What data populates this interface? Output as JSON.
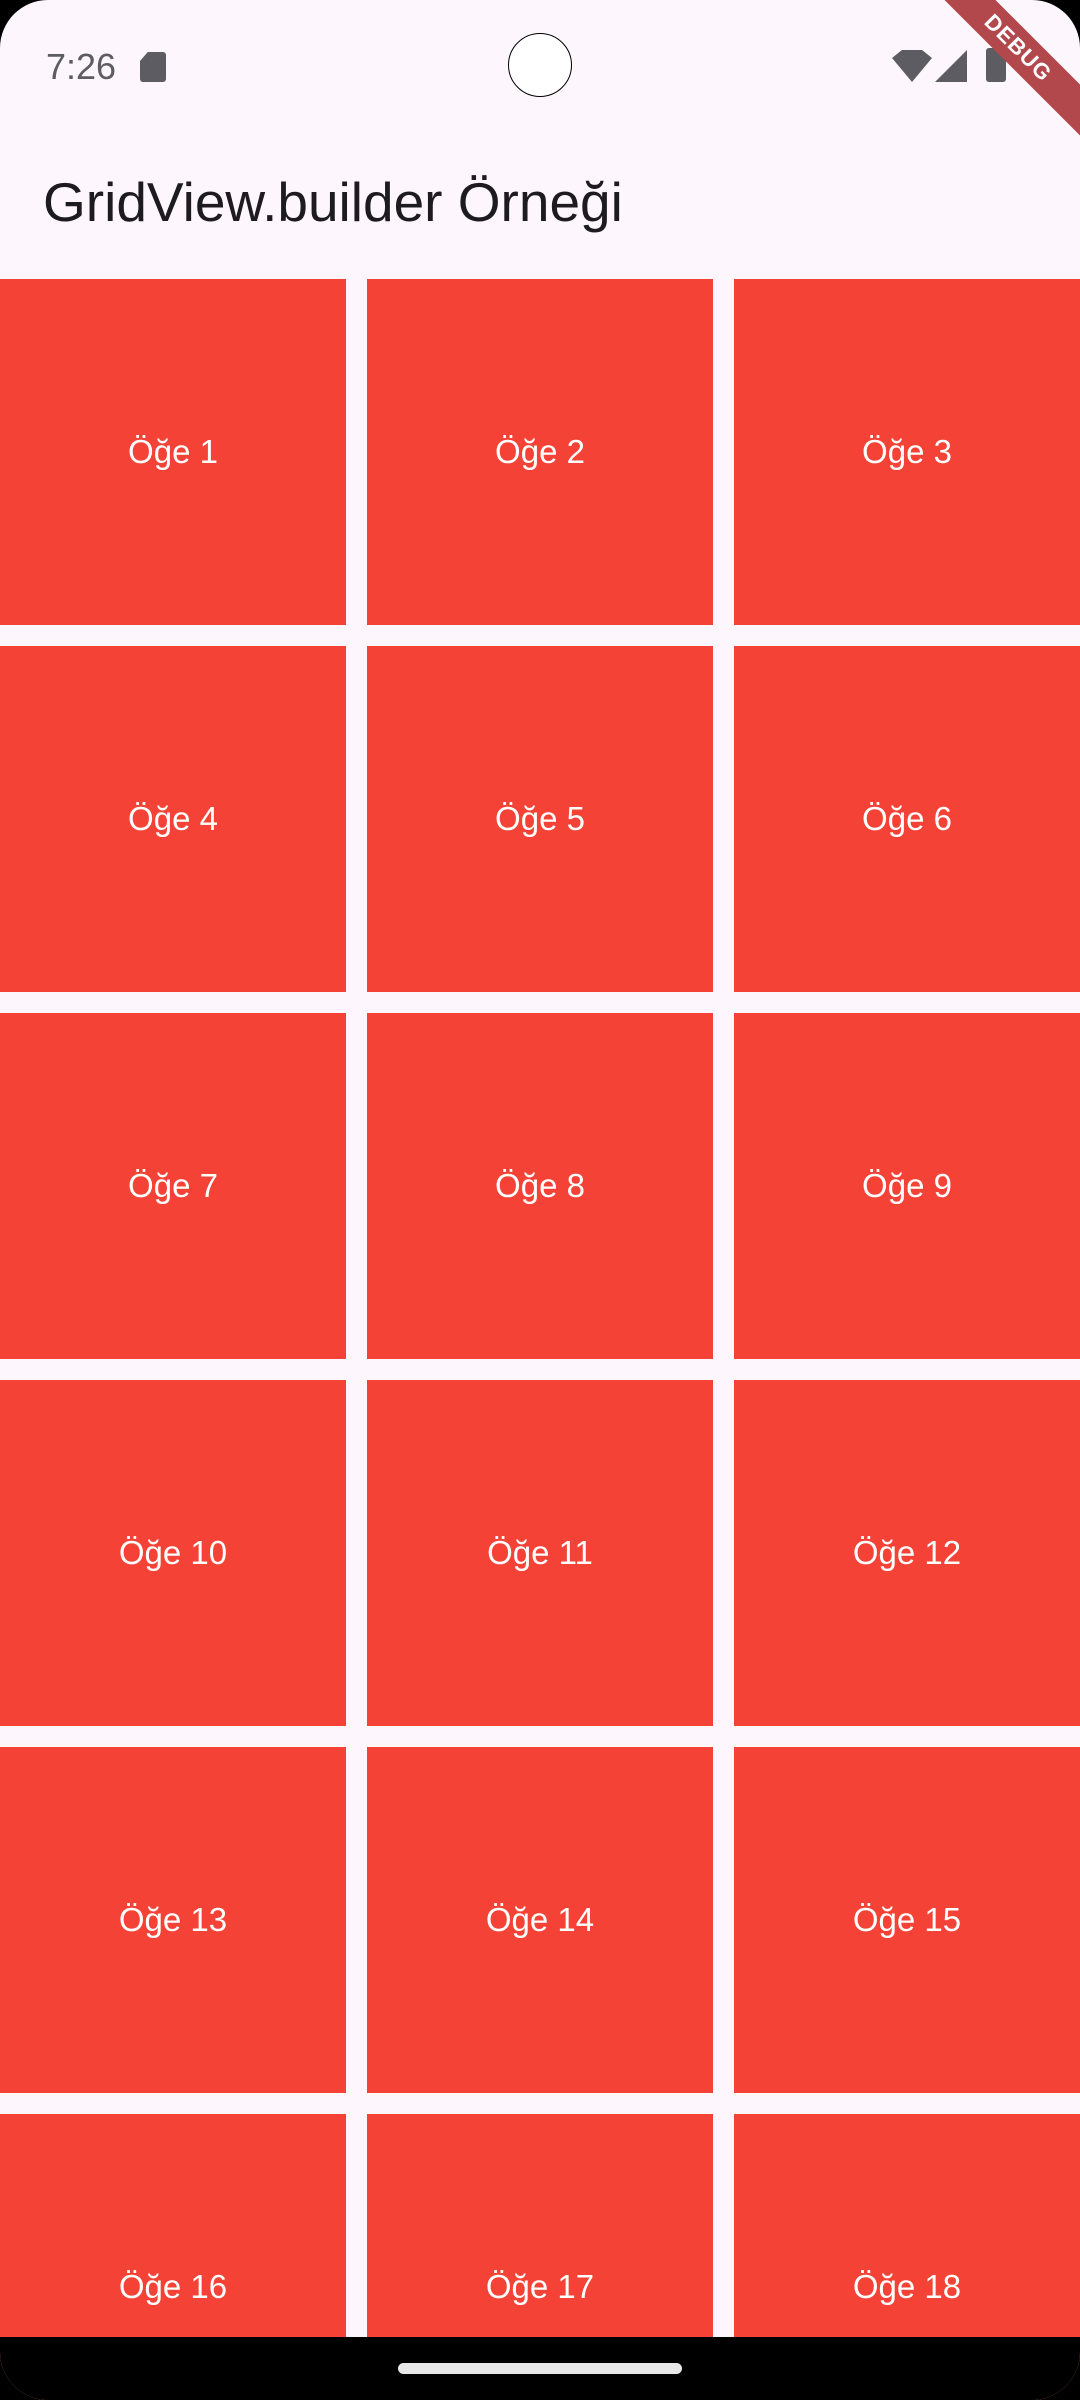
{
  "status_bar": {
    "time": "7:26",
    "icons": [
      "sd-card-icon",
      "wifi-icon",
      "signal-icon",
      "battery-icon"
    ]
  },
  "debug_banner": "DEBUG",
  "app_bar": {
    "title": "GridView.builder Örneği"
  },
  "colors": {
    "tile": "#f44336",
    "background": "#fdf6fc"
  },
  "grid": {
    "items": [
      "Öğe 1",
      "Öğe 2",
      "Öğe 3",
      "Öğe 4",
      "Öğe 5",
      "Öğe 6",
      "Öğe 7",
      "Öğe 8",
      "Öğe 9",
      "Öğe 10",
      "Öğe 11",
      "Öğe 12",
      "Öğe 13",
      "Öğe 14",
      "Öğe 15",
      "Öğe 16",
      "Öğe 17",
      "Öğe 18"
    ]
  }
}
